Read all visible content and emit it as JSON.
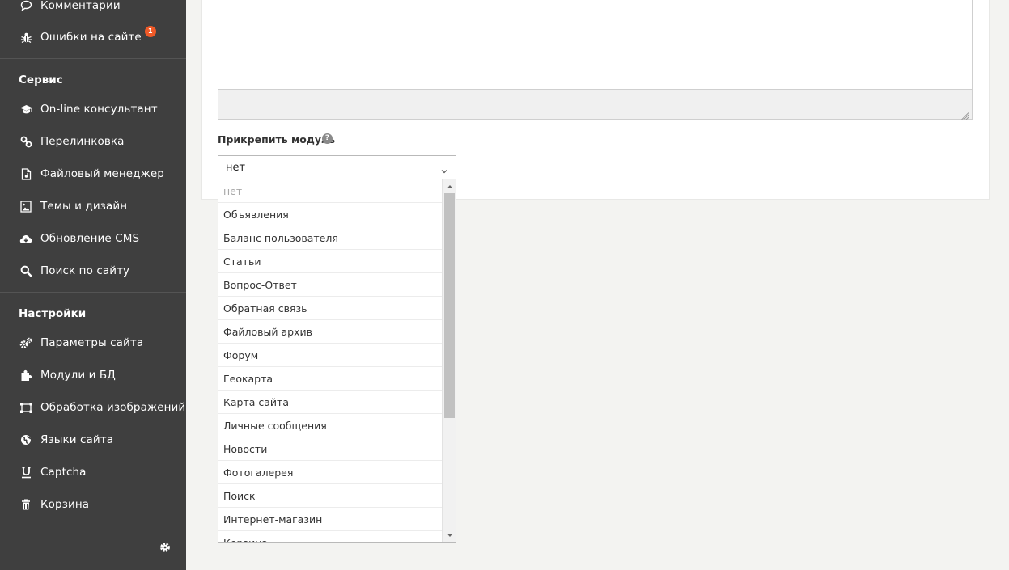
{
  "sidebar": {
    "top_items": [
      {
        "label": "Комментарии",
        "icon": "comment-icon"
      },
      {
        "label": "Ошибки на сайте",
        "icon": "bug-icon",
        "badge": "1"
      }
    ],
    "sections": [
      {
        "title": "Сервис",
        "items": [
          {
            "label": "On-line консультант",
            "icon": "graduation-cap-icon"
          },
          {
            "label": "Перелинковка",
            "icon": "link-icon"
          },
          {
            "label": "Файловый менеджер",
            "icon": "file-icon"
          },
          {
            "label": "Темы и дизайн",
            "icon": "image-icon"
          },
          {
            "label": "Обновление CMS",
            "icon": "cloud-download-icon"
          },
          {
            "label": "Поиск по сайту",
            "icon": "search-icon"
          }
        ]
      },
      {
        "title": "Настройки",
        "items": [
          {
            "label": "Параметры сайта",
            "icon": "gears-icon"
          },
          {
            "label": "Модули и БД",
            "icon": "puzzle-icon"
          },
          {
            "label": "Обработка изображений",
            "icon": "crop-icon"
          },
          {
            "label": "Языки сайта",
            "icon": "globe-icon"
          },
          {
            "label": "Captcha",
            "icon": "underline-icon"
          },
          {
            "label": "Корзина",
            "icon": "trash-icon"
          }
        ]
      }
    ],
    "footer_icon": "gear-icon"
  },
  "form": {
    "field_label": "Прикрепить модуль",
    "help_icon": "question-circle-icon",
    "help_glyph": "?",
    "select_value": "нет",
    "options": [
      {
        "label": "нет",
        "disabled": true
      },
      {
        "label": "Объявления"
      },
      {
        "label": "Баланс пользователя"
      },
      {
        "label": "Статьи"
      },
      {
        "label": "Вопрос-Ответ"
      },
      {
        "label": "Обратная связь"
      },
      {
        "label": "Файловый архив"
      },
      {
        "label": "Форум"
      },
      {
        "label": "Геокарта"
      },
      {
        "label": "Карта сайта"
      },
      {
        "label": "Личные сообщения"
      },
      {
        "label": "Новости"
      },
      {
        "label": "Фотогалерея"
      },
      {
        "label": "Поиск"
      },
      {
        "label": "Интернет-магазин"
      },
      {
        "label": "Корзина"
      }
    ]
  },
  "colors": {
    "sidebar_bg": "#3f3f3f",
    "badge": "#f05a28",
    "page_bg": "#f3f3f1"
  }
}
